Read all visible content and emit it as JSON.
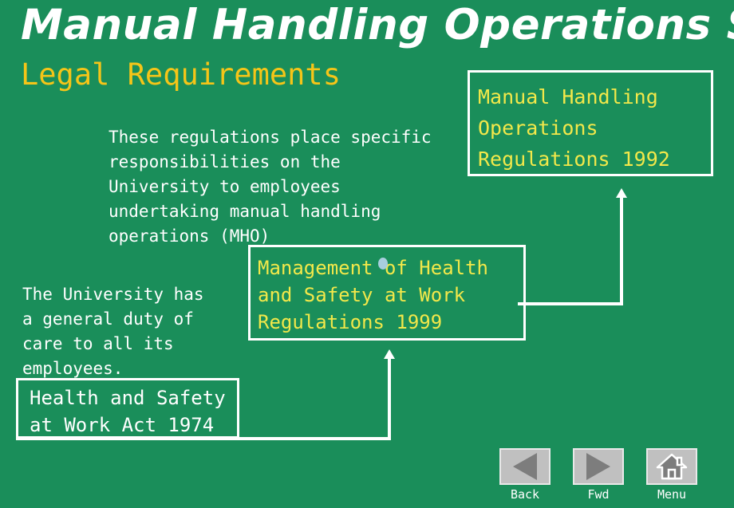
{
  "slide": {
    "background_color": "#1a8e5a",
    "title": "Manual Handling Operations Safety",
    "subtitle": "Legal Requirements"
  },
  "body": {
    "paragraph_regulations": "These regulations place specific\nresponsibilities on the\nUniversity to employees\nundertaking manual handling\noperations (MHO)",
    "paragraph_duty": "The University has\na general duty of\ncare to all its\nemployees."
  },
  "callouts": [
    {
      "id": "mho",
      "text": "Manual Handling\nOperations\nRegulations 1992",
      "text_color": "#f2e84a",
      "border_color": "#ffffff"
    },
    {
      "id": "mhsw",
      "text": "Management of Health\nand Safety at Work\nRegulations 1999",
      "text_color": "#f2e84a",
      "border_color": "#ffffff"
    },
    {
      "id": "hasawa",
      "text": "Health and Safety\nat Work Act 1974",
      "text_color": "#ffffff",
      "border_color": "#ffffff"
    }
  ],
  "nav": {
    "buttons": [
      {
        "label": "Back",
        "icon": "triangle-left-icon"
      },
      {
        "label": "Fwd",
        "icon": "triangle-right-icon"
      },
      {
        "label": "Menu",
        "icon": "home-icon"
      }
    ]
  }
}
